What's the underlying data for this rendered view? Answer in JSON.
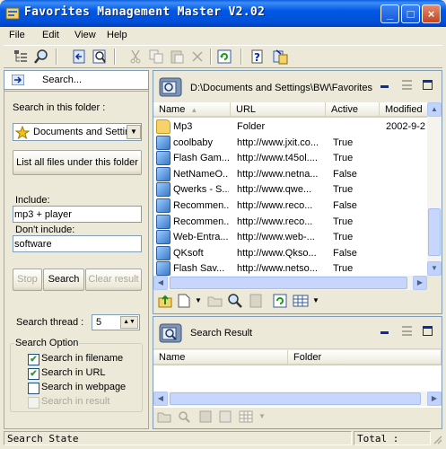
{
  "window": {
    "title": "Favorites Management Master V2.02",
    "min": "_",
    "max": "□",
    "close": "×"
  },
  "menu": [
    "File",
    "Edit",
    "View",
    "Help"
  ],
  "toolbar_icons": [
    "tree-view-icon",
    "find-icon",
    "back-icon",
    "search-icon",
    "cut-icon",
    "copy-icon",
    "paste-icon",
    "delete-icon",
    "refresh-icon",
    "help-icon",
    "export-icon"
  ],
  "search": {
    "go_label": "Search...",
    "folder_label": "Search in this folder :",
    "folder_value": "Documents and Settin",
    "list_all_label": "List all files under this folder",
    "include_label": "Include:",
    "include_value": "mp3 + player",
    "exclude_label": "Don't include:",
    "exclude_value": "software",
    "stop_label": "Stop",
    "search_label": "Search",
    "clear_label": "Clear result",
    "thread_label": "Search thread :",
    "thread_value": "5",
    "option_title": "Search Option",
    "options": [
      {
        "label": "Search in filename",
        "checked": true,
        "enabled": true
      },
      {
        "label": "Search in URL",
        "checked": true,
        "enabled": true
      },
      {
        "label": "Search in webpage",
        "checked": false,
        "enabled": true
      },
      {
        "label": "Search in result",
        "checked": false,
        "enabled": false
      }
    ]
  },
  "favorites": {
    "path": "D:\\Documents and Settings\\BW\\Favorites",
    "columns": [
      "Name",
      "URL",
      "Active",
      "Modified"
    ],
    "rows": [
      {
        "icon": "folder-icon",
        "name": "Mp3",
        "url": "Folder",
        "active": "",
        "modified": "2002-9-2"
      },
      {
        "icon": "ie-icon",
        "name": "coolbaby",
        "url": "http://www.jxit.co...",
        "active": "True",
        "modified": ""
      },
      {
        "icon": "ie-icon",
        "name": "Flash Gam...",
        "url": "http://www.t45ol....",
        "active": "True",
        "modified": ""
      },
      {
        "icon": "ie-icon",
        "name": "NetNameO...",
        "url": "http://www.netna...",
        "active": "False",
        "modified": ""
      },
      {
        "icon": "ie-icon",
        "name": "Qwerks - S...",
        "url": "http://www.qwe...",
        "active": "True",
        "modified": ""
      },
      {
        "icon": "ie-icon",
        "name": "Recommen...",
        "url": "http://www.reco...",
        "active": "False",
        "modified": ""
      },
      {
        "icon": "ie-icon",
        "name": "Recommen...",
        "url": "http://www.reco...",
        "active": "True",
        "modified": ""
      },
      {
        "icon": "ie-icon",
        "name": "Web-Entra...",
        "url": "http://www.web-...",
        "active": "True",
        "modified": ""
      },
      {
        "icon": "ie-icon",
        "name": "QKsoft",
        "url": "http://www.Qkso...",
        "active": "False",
        "modified": ""
      },
      {
        "icon": "ie-icon",
        "name": "Flash Sav...",
        "url": "http://www.netso...",
        "active": "True",
        "modified": ""
      }
    ]
  },
  "results": {
    "title": "Search Result",
    "columns": [
      "Name",
      "Folder"
    ]
  },
  "status": {
    "state": "Search State",
    "total": "Total :"
  }
}
